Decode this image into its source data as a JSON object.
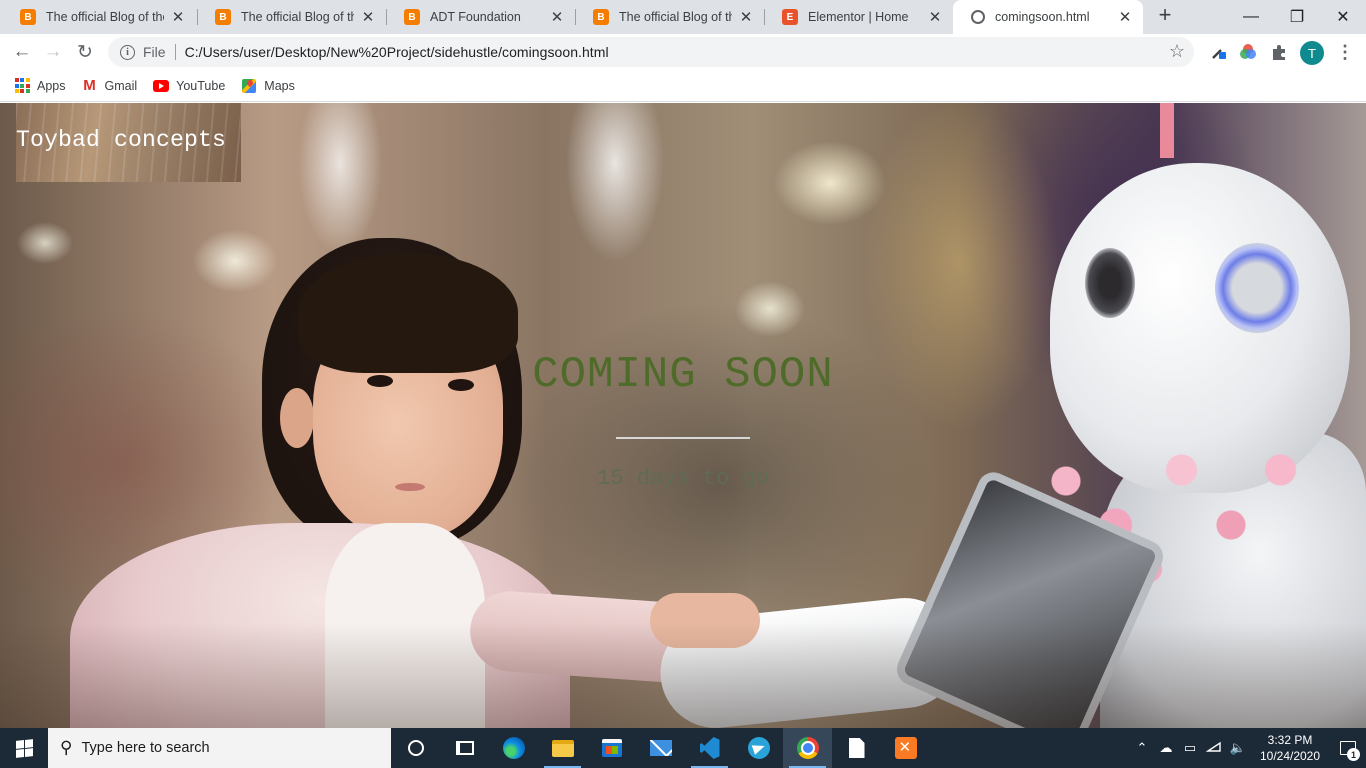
{
  "browser": {
    "tabs": [
      {
        "title": "The official Blog of the",
        "icon": "blogger-icon"
      },
      {
        "title": "The official Blog of the",
        "icon": "blogger-icon"
      },
      {
        "title": "ADT Foundation",
        "icon": "blogger-icon"
      },
      {
        "title": "The official Blog of the",
        "icon": "blogger-icon"
      },
      {
        "title": "Elementor | Home",
        "icon": "elementor-icon"
      },
      {
        "title": "comingsoon.html",
        "icon": "globe-icon",
        "active": true
      }
    ],
    "new_tab": "+",
    "address_bar": {
      "scheme_label": "File",
      "url": "C:/Users/user/Desktop/New%20Project/sidehustle/comingsoon.html"
    },
    "profile_initial": "T",
    "bookmarks": [
      {
        "label": "Apps",
        "icon": "apps-grid-icon"
      },
      {
        "label": "Gmail",
        "icon": "gmail-icon"
      },
      {
        "label": "YouTube",
        "icon": "youtube-icon"
      },
      {
        "label": "Maps",
        "icon": "maps-icon"
      }
    ]
  },
  "page": {
    "brand": "Toybad concepts",
    "heading": "COMING SOON",
    "countdown": "15 days to go"
  },
  "taskbar": {
    "search_placeholder": "Type here to search",
    "apps": [
      "cortana-icon",
      "task-view-icon",
      "edge-icon",
      "file-explorer-icon",
      "store-icon",
      "mail-icon",
      "vscode-icon",
      "telegram-icon",
      "chrome-icon",
      "notepad-file-icon",
      "xampp-icon"
    ],
    "clock_time": "3:32 PM",
    "clock_date": "10/24/2020",
    "notification_count": "1"
  },
  "colors": {
    "heading": "#4f6b2a",
    "taskbar": "#1c2936",
    "tab_strip": "#dee1e6"
  }
}
